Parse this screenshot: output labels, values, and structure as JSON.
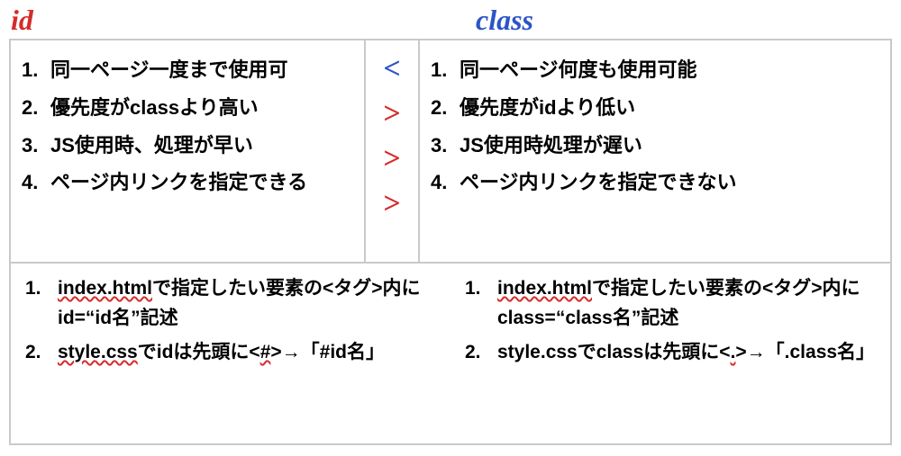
{
  "headers": {
    "left": "id",
    "right": "class"
  },
  "arrows": [
    "<",
    ">",
    ">",
    ">"
  ],
  "left_features": {
    "items": [
      {
        "n": "1.",
        "t": "同一ページ一度まで使用可"
      },
      {
        "n": "2.",
        "t": "優先度がclassより高い"
      },
      {
        "n": "3.",
        "t": "JS使用時、処理が早い"
      },
      {
        "n": "4.",
        "t": "ページ内リンクを指定できる"
      }
    ]
  },
  "right_features": {
    "items": [
      {
        "n": "1.",
        "t": "同一ページ何度も使用可能"
      },
      {
        "n": "2.",
        "t": "優先度がidより低い"
      },
      {
        "n": "3.",
        "t": "JS使用時処理が遅い"
      },
      {
        "n": "4.",
        "t": "ページ内リンクを指定できない"
      }
    ]
  },
  "left_howto": {
    "i1": {
      "n": "1.",
      "p1": "index.html",
      "p2": "で指定したい要素の<タグ>内にid=“id名”記述"
    },
    "i2": {
      "n": "2.",
      "p1": "style.css",
      "p2": "でidは先頭に<",
      "p3": "#",
      "p4": ">→「#id名」"
    }
  },
  "right_howto": {
    "i1": {
      "n": "1.",
      "p1": "index.html",
      "p2": "で指定したい要素の<タグ>内にclass=“class名”記述"
    },
    "i2": {
      "n": "2.",
      "p1": "style.cssでclassは先頭に<",
      "p2": ".",
      "p3": ">→「.class名」"
    }
  }
}
